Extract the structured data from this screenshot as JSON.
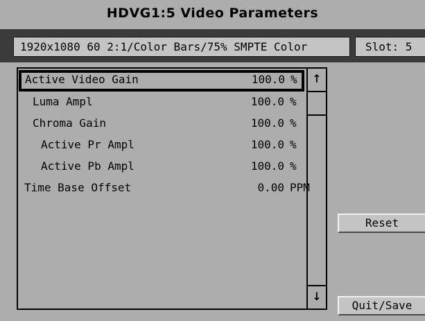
{
  "window": {
    "title": "HDVG1:5  Video Parameters"
  },
  "status": {
    "format": "1920x1080  60 2:1/Color Bars/75% SMPTE  Color",
    "slot": "Slot: 5"
  },
  "parameters": [
    {
      "label": "Active Video Gain",
      "value": "100.0",
      "unit": "%",
      "indent": 0,
      "selected": true
    },
    {
      "label": "Luma Ampl",
      "value": "100.0",
      "unit": "%",
      "indent": 1,
      "selected": false
    },
    {
      "label": "Chroma Gain",
      "value": "100.0",
      "unit": "%",
      "indent": 1,
      "selected": false
    },
    {
      "label": "Active Pr Ampl",
      "value": "100.0",
      "unit": "%",
      "indent": 2,
      "selected": false
    },
    {
      "label": "Active Pb Ampl",
      "value": "100.0",
      "unit": "%",
      "indent": 2,
      "selected": false
    },
    {
      "label": "Time Base Offset",
      "value": "0.00",
      "unit": "PPM",
      "indent": 0,
      "selected": false
    }
  ],
  "scroll": {
    "up_icon": "arrow-up-icon",
    "down_icon": "arrow-down-icon",
    "up_glyph": "↑",
    "down_glyph": "↓"
  },
  "buttons": {
    "reset": "Reset",
    "quit_save": "Quit/Save"
  }
}
